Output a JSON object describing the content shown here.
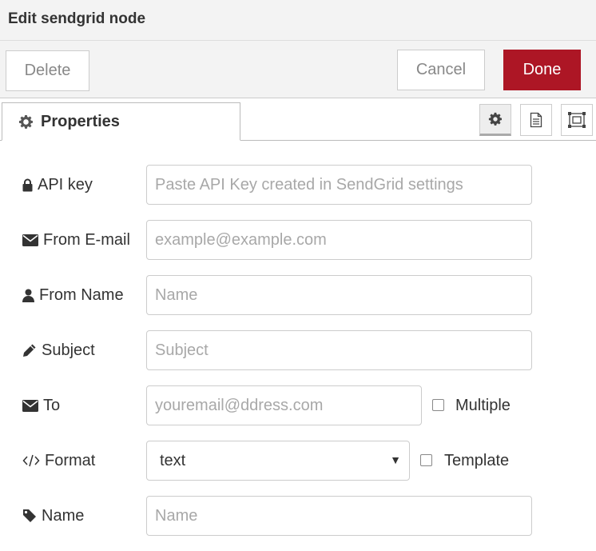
{
  "dialog": {
    "title": "Edit sendgrid node"
  },
  "toolbar": {
    "delete_label": "Delete",
    "cancel_label": "Cancel",
    "done_label": "Done"
  },
  "tabs": {
    "properties_label": "Properties",
    "icons": [
      "gear-icon",
      "description-icon",
      "appearance-icon"
    ]
  },
  "form": {
    "api_key": {
      "label": "API key",
      "placeholder": "Paste API Key created in SendGrid settings",
      "value": ""
    },
    "from_email": {
      "label": "From E-mail",
      "placeholder": "example@example.com",
      "value": ""
    },
    "from_name": {
      "label": "From Name",
      "placeholder": "Name",
      "value": ""
    },
    "subject": {
      "label": "Subject",
      "placeholder": "Subject",
      "value": ""
    },
    "to": {
      "label": "To",
      "placeholder": "youremail@ddress.com",
      "value": "",
      "multiple_label": "Multiple",
      "multiple_checked": false
    },
    "format": {
      "label": "Format",
      "selected": "text",
      "template_label": "Template",
      "template_checked": false
    },
    "name": {
      "label": "Name",
      "placeholder": "Name",
      "value": ""
    }
  },
  "colors": {
    "accent": "#ad1625",
    "header_bg": "#f3f3f3"
  }
}
